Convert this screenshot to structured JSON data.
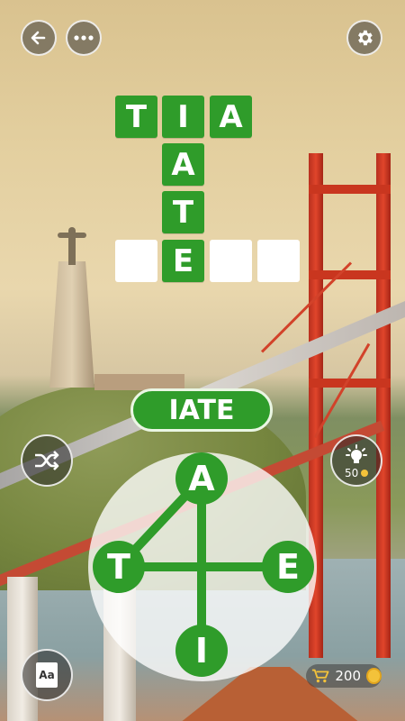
{
  "header": {
    "back_icon": "arrow-left-icon",
    "more_icon": "more-dots-icon",
    "settings_icon": "gear-icon"
  },
  "crossword": {
    "row1": [
      "T",
      "I",
      "A"
    ],
    "column": [
      "I",
      "A",
      "T",
      "E"
    ],
    "row4": [
      "",
      "",
      "E",
      "",
      ""
    ]
  },
  "current_word": "IATE",
  "wheel": {
    "letters": {
      "top": "A",
      "left": "T",
      "right": "E",
      "bottom": "I"
    }
  },
  "shuffle_icon": "shuffle-icon",
  "hint": {
    "icon": "lightbulb-icon",
    "cost": "50"
  },
  "dictionary": {
    "label": "Aa"
  },
  "coins": {
    "icon": "cart-icon",
    "amount": "200"
  },
  "colors": {
    "tile_green": "#2f9c2a",
    "coin_gold": "#f3c23a",
    "bridge_red": "#d2422a"
  }
}
